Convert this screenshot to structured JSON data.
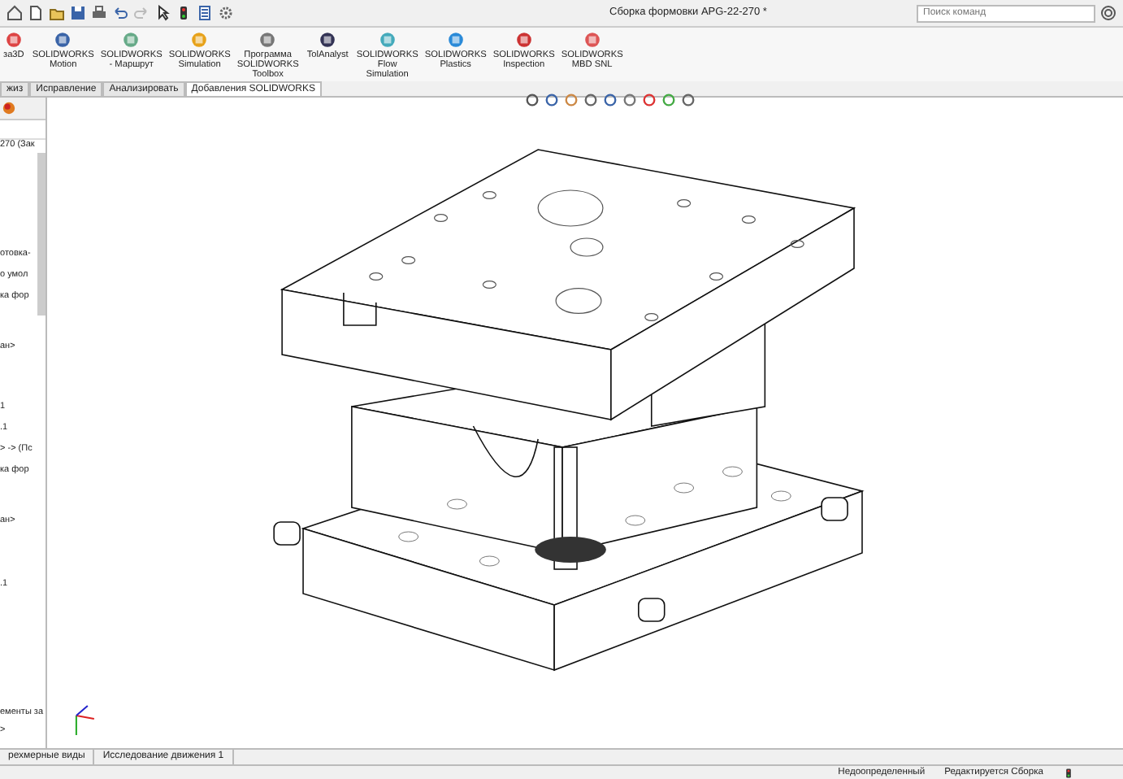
{
  "window": {
    "title": "Сборка формовки APG-22-270 *",
    "search": {
      "placeholder": "Поиск команд"
    }
  },
  "ribbon": {
    "items": [
      {
        "label": "за3D"
      },
      {
        "label": "SOLIDWORKS Motion"
      },
      {
        "label": "SOLIDWORKS - Маршрут"
      },
      {
        "label": "SOLIDWORKS Simulation"
      },
      {
        "label": "Программа SOLIDWORKS Toolbox"
      },
      {
        "label": "TolAnalyst"
      },
      {
        "label": "SOLIDWORKS Flow Simulation"
      },
      {
        "label": "SOLIDWORKS Plastics"
      },
      {
        "label": "SOLIDWORKS Inspection"
      },
      {
        "label": "SOLIDWORKS MBD SNL"
      }
    ]
  },
  "tabs": [
    {
      "label": "жиз",
      "selected": false
    },
    {
      "label": "Исправление",
      "selected": false
    },
    {
      "label": "Анализировать",
      "selected": false
    },
    {
      "label": "Добавления SOLIDWORKS",
      "selected": true
    }
  ],
  "feature_tree": {
    "lines": [
      "270 (Зак",
      "отовка-",
      "о умол",
      "ка фор",
      "ан>",
      "1",
      ".1",
      "> -> (Пс",
      "ка фор",
      "ан>",
      ".1",
      "ементы за",
      ">"
    ]
  },
  "bottom_tabs": [
    {
      "label": "рехмерные виды",
      "selected": false
    },
    {
      "label": "Исследование движения 1",
      "selected": false
    }
  ],
  "status_bar": {
    "texts": [
      "Недоопределенный",
      "Редактируется Сборка"
    ]
  }
}
